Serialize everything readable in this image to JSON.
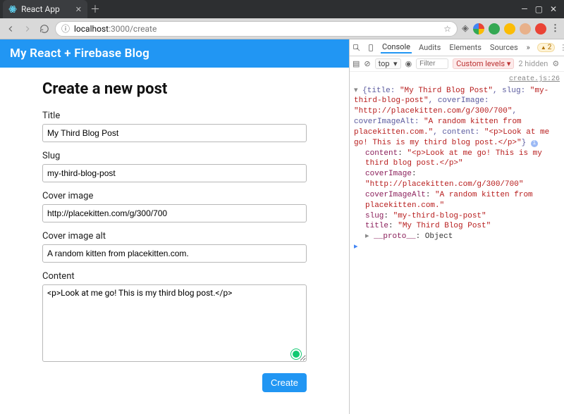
{
  "browser": {
    "tabTitle": "React App",
    "url": {
      "host": "localhost",
      "port": ":3000",
      "path": "/create"
    }
  },
  "app": {
    "brand": "My React + Firebase Blog",
    "formTitle": "Create a new post",
    "labels": {
      "title": "Title",
      "slug": "Slug",
      "coverImage": "Cover image",
      "coverImageAlt": "Cover image alt",
      "content": "Content"
    },
    "values": {
      "title": "My Third Blog Post",
      "slug": "my-third-blog-post",
      "coverImage": "http://placekitten.com/g/300/700",
      "coverImageAlt": "A random kitten from placekitten.com.",
      "content": "<p>Look at me go! This is my third blog post.</p>"
    },
    "actions": {
      "create": "Create"
    }
  },
  "devtools": {
    "tabs": [
      "Console",
      "Audits",
      "Elements",
      "Sources"
    ],
    "activeTab": "Console",
    "warnCount": "2",
    "contextSelector": "top",
    "filterPlaceholder": "Filter",
    "levels": "Custom levels ▾",
    "hidden": "2 hidden",
    "sourceLink": "create.js:26",
    "summary": "{title: \"My Third Blog Post\", slug: \"my-third-blog-post\", coverImage: \"http://placekitten.com/g/300/700\", coverImageAlt: \"A random kitten from placekitten.com.\", content: \"<p>Look at me go! This is my third blog post.</p>\"}",
    "obj": {
      "content": "\"<p>Look at me go! This is my third blog post.</p>\"",
      "coverImage": "\"http://placekitten.com/g/300/700\"",
      "coverImageAlt": "\"A random kitten from placekitten.com.\"",
      "slug": "\"my-third-blog-post\"",
      "title": "\"My Third Blog Post\""
    },
    "protoLabel": "__proto__",
    "protoValue": ": Object"
  }
}
